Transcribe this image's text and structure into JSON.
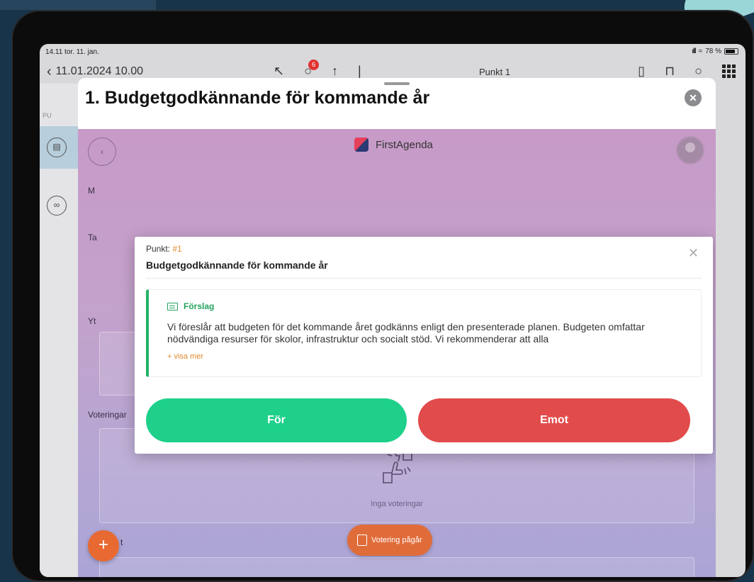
{
  "status_bar": {
    "time_date": "14.11  tor. 11. jan.",
    "battery": "78 %"
  },
  "toolbar": {
    "back_label": "11.01.2024 10.00",
    "badge_count": "6",
    "title": "Punkt 1"
  },
  "sidebar": {
    "section_label": "PU"
  },
  "sheet": {
    "title": "1. Budgetgodkännande för kommande år"
  },
  "app": {
    "brand": "FirstAgenda"
  },
  "background": {
    "labels": [
      "M",
      "Ta",
      "Yt"
    ],
    "votes_label": "Voteringar",
    "votes_empty": "Inga voteringar",
    "lower_label": "t",
    "pill_label": "Votering pågår"
  },
  "modal": {
    "punkt_prefix": "Punkt:",
    "punkt_number": "#1",
    "title": "Budgetgodkännande för kommande år",
    "proposal_heading": "Förslag",
    "proposal_text": "Vi föreslår att budgeten för det kommande året godkänns enligt den presenterade planen. Budgeten omfattar nödvändiga resurser för skolor, infrastruktur och socialt stöd. Vi rekommenderar att alla",
    "show_more": "+ visa mer",
    "btn_for": "För",
    "btn_against": "Emot"
  },
  "colors": {
    "for": "#1ed08a",
    "against": "#e24b4b",
    "proposal_accent": "#24b26a",
    "orange": "#e48a2c"
  }
}
